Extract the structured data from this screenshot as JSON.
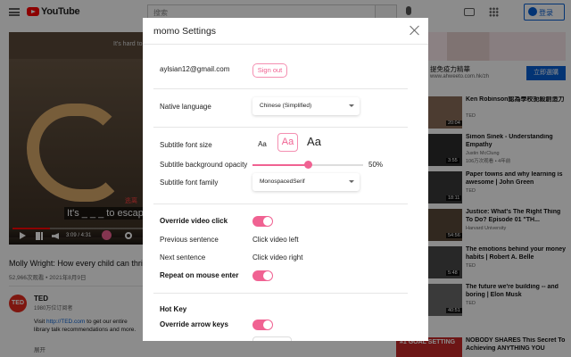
{
  "youtube": {
    "brand": "YouTube",
    "search_placeholder": "搜索",
    "signin": "登录",
    "video": {
      "caption_top": "It's hard to",
      "caption_red": "逃离",
      "caption_main": "It's _ _ _ to escap",
      "time": "3:09 / 4:31",
      "progress": 0.28
    },
    "title": "Molly Wright: How every child can thrive by",
    "meta": "52,966次观看 • 2021年8月9日",
    "channel": {
      "avatar": "TED",
      "name": "TED",
      "subs": "1980万位订阅者",
      "desc_prefix": "Visit",
      "desc_link": "http://TED.com",
      "desc_rest": "to get our entire library talk recommendations and more.",
      "more": "展开"
    },
    "ad": {
      "headline": "提免疫力精華",
      "url": "www.ahweeto.com.hk/zh",
      "cta": "立即選購"
    },
    "recommendations": [
      {
        "title": "Ken Robinson認為學校扼殺創造力",
        "channel": "TED",
        "views": "",
        "duration": "20:04"
      },
      {
        "title": "Simon Sinek - Understanding Empathy",
        "channel": "Justin McClung",
        "views": "106万次观看 • 4年前",
        "duration": "3:55"
      },
      {
        "title": "Paper towns and why learning is awesome | John Green",
        "channel": "TED",
        "views": "",
        "duration": "18:11"
      },
      {
        "title": "Justice: What's The Right Thing To Do? Episode 01 \"TH...",
        "channel": "Harvard University",
        "views": "",
        "duration": "54:56"
      },
      {
        "title": "The emotions behind your money habits | Robert A. Belle",
        "channel": "TED",
        "views": "",
        "duration": "5:48"
      },
      {
        "title": "The future we're building -- and boring | Elon Musk",
        "channel": "TED",
        "views": "",
        "duration": "40:51"
      },
      {
        "title": "NOBODY SHARES This Secret To Achieving ANYTHING YOU",
        "channel": "",
        "views": "",
        "duration": ""
      }
    ],
    "rec_thumb_text": "#1 GOAL SETTING"
  },
  "modal": {
    "title": "momo Settings",
    "account": {
      "email": "aylsian12@gmail.com",
      "signout": "Sign out"
    },
    "native_language": {
      "label": "Native language",
      "value": "Chinese (Simplified)"
    },
    "font_size": {
      "label": "Subtitle font size",
      "options": [
        "Aa",
        "Aa",
        "Aa"
      ],
      "selected": 1
    },
    "bg_opacity": {
      "label": "Subtitle background opacity",
      "value": 0.5,
      "display": "50%"
    },
    "font_family": {
      "label": "Subtitle font family",
      "value": "MonospacedSerif"
    },
    "override_click": {
      "label": "Override video click",
      "on": true
    },
    "prev_sentence": {
      "label": "Previous sentence",
      "value": "Click video left"
    },
    "next_sentence": {
      "label": "Next sentence",
      "value": "Click video right"
    },
    "repeat_mouse": {
      "label": "Repeat on mouse enter",
      "on": true
    },
    "hotkey": {
      "label": "Hot Key"
    },
    "override_arrows": {
      "label": "Override arrow keys",
      "on": true
    }
  },
  "colors": {
    "accent": "#f06292",
    "accent_border": "#f48fb1",
    "yt_red": "#ff0000",
    "yt_blue": "#065fd4"
  }
}
